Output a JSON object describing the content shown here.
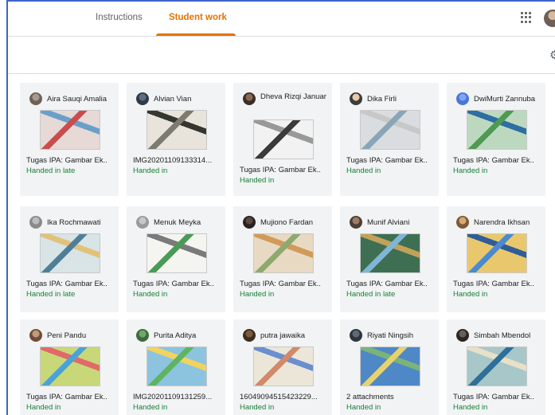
{
  "tabs": {
    "instructions": "Instructions",
    "student_work": "Student work"
  },
  "header": {
    "apps_icon": "apps-grid-icon",
    "settings_icon": "gear-icon",
    "settings_glyph": "⚙"
  },
  "colors": {
    "accent": "#e37400",
    "handed_in": "#188038",
    "card_bg": "#f1f3f4"
  },
  "students": [
    {
      "name": "Aira Sauqi Amalia",
      "file": "Tugas IPA: Gambar Ek..",
      "status": "Handed in late"
    },
    {
      "name": "Alvian Vian",
      "file": "IMG20201109133314...",
      "status": "Handed in"
    },
    {
      "name": "Dheva Rizqi Januar",
      "file": "Tugas IPA: Gambar Ek..",
      "status": "Handed in"
    },
    {
      "name": "Dika Firli",
      "file": "Tugas IPA: Gambar Ek..",
      "status": "Handed in"
    },
    {
      "name": "DwiMurti Zannuba",
      "file": "Tugas IPA: Gambar Ek..",
      "status": "Handed in"
    },
    {
      "name": "Ika Rochmawati",
      "file": "Tugas IPA: Gambar Ek..",
      "status": "Handed in late"
    },
    {
      "name": "Menuk Meyka",
      "file": "Tugas IPA: Gambar Ek..",
      "status": "Handed in"
    },
    {
      "name": "Mujiono Fardan",
      "file": "Tugas IPA: Gambar Ek..",
      "status": "Handed in"
    },
    {
      "name": "Munif Alviani",
      "file": "Tugas IPA: Gambar Ek..",
      "status": "Handed in late"
    },
    {
      "name": "Narendra Ikhsan",
      "file": "Tugas IPA: Gambar Ek..",
      "status": "Handed in"
    },
    {
      "name": "Peni Pandu",
      "file": "Tugas IPA: Gambar Ek..",
      "status": "Handed in"
    },
    {
      "name": "Purita Aditya",
      "file": "IMG20201109131259...",
      "status": "Handed in"
    },
    {
      "name": "putra jawaika",
      "file": "16049094515423229...",
      "status": "Handed in"
    },
    {
      "name": "Riyati Ningsih",
      "file": "2 attachments",
      "status": "Handed in"
    },
    {
      "name": "Simbah Mbendol",
      "file": "Tugas IPA: Gambar Ek..",
      "status": "Handed in"
    }
  ]
}
